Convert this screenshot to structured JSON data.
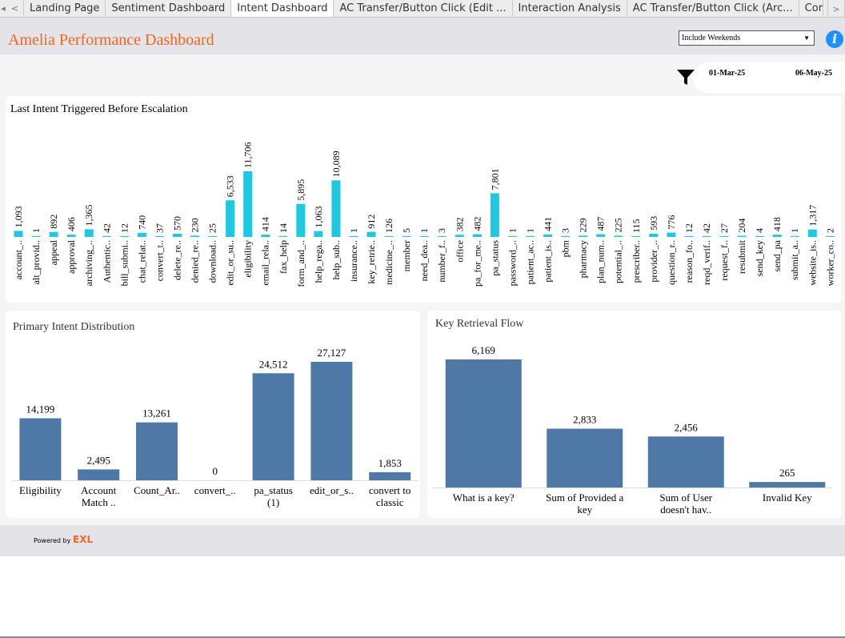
{
  "tabs": [
    {
      "label": "Landing Page",
      "active": false
    },
    {
      "label": "Sentiment Dashboard",
      "active": false
    },
    {
      "label": "Intent Dashboard",
      "active": true
    },
    {
      "label": "AC Transfer/Button Click (Edit ...",
      "active": false
    },
    {
      "label": "Interaction Analysis",
      "active": false
    },
    {
      "label": "AC Transfer/Button Click (Arc...",
      "active": false
    },
    {
      "label": "Cor",
      "active": false
    }
  ],
  "tab_nav": {
    "prev": "<",
    "next": ">",
    "first": "◂"
  },
  "header": {
    "title": "Amelia Performance Dashboard",
    "weekend_select_value": "Include Weekends",
    "info_icon": "i"
  },
  "date_filter": {
    "start": "01-Mar-25",
    "end": "06-May-25"
  },
  "footer": {
    "powered_by": "Powered by",
    "logo_text": "EXL"
  },
  "colors": {
    "accent": "#f26522",
    "cyan_bar": "#1ec8e1",
    "blue_bar": "#4e79a7",
    "info": "#1e90ff"
  },
  "chart_data": [
    {
      "type": "bar",
      "title": "Last Intent Triggered Before Escalation",
      "categories": [
        "account_..",
        "alt_provid..",
        "appeal",
        "approval",
        "archiving_..",
        "Authentic..",
        "bill_submi..",
        "chat_relat..",
        "convert_t..",
        "delete_re..",
        "denied_re..",
        "download..",
        "edit_or_su..",
        "eligibility",
        "email_rela..",
        "fax_help",
        "form_and_..",
        "help_rega..",
        "help_sub..",
        "insurance..",
        "key_retrie..",
        "medicine_..",
        "member",
        "need_dea..",
        "number_f..",
        "office",
        "pa_for_me..",
        "pa_status",
        "password_..",
        "patient_ac..",
        "patient_is..",
        "pbm",
        "pharmacy",
        "plan_num..",
        "potential_..",
        "prescriber..",
        "provider_..",
        "question_r..",
        "reason_fo..",
        "reqd_verif..",
        "request_f..",
        "resubmit",
        "send_key",
        "send_pa",
        "submit_a..",
        "website_is..",
        "worker_co.."
      ],
      "values": [
        1093,
        1,
        892,
        406,
        1365,
        42,
        12,
        740,
        37,
        570,
        230,
        25,
        6533,
        11706,
        414,
        14,
        5895,
        1063,
        10089,
        1,
        912,
        126,
        5,
        1,
        3,
        382,
        482,
        7801,
        1,
        1,
        441,
        3,
        229,
        487,
        225,
        115,
        593,
        776,
        12,
        42,
        27,
        204,
        4,
        418,
        1,
        1317,
        2
      ],
      "labels": [
        "1,093",
        "1",
        "892",
        "406",
        "1,365",
        "42",
        "12",
        "740",
        "37",
        "570",
        "230",
        "25",
        "6,533",
        "11,706",
        "414",
        "14",
        "5,895",
        "1,063",
        "10,089",
        "1",
        "912",
        "126",
        "5",
        "1",
        "3",
        "382",
        "482",
        "7,801",
        "1",
        "1",
        "441",
        "3",
        "229",
        "487",
        "225",
        "115",
        "593",
        "776",
        "12",
        "42",
        "27",
        "204",
        "4",
        "418",
        "1",
        "1,317",
        "2"
      ],
      "color": "#1ec8e1"
    },
    {
      "type": "bar",
      "title": "Primary Intent Distribution",
      "categories": [
        [
          "Eligibility"
        ],
        [
          "Account",
          "Match .."
        ],
        [
          "Count_Ar.."
        ],
        [
          "convert_.."
        ],
        [
          "pa_status",
          "(1)"
        ],
        [
          "edit_or_s.."
        ],
        [
          "convert to",
          "classic"
        ]
      ],
      "values": [
        14199,
        2495,
        13261,
        0,
        24512,
        27127,
        1853
      ],
      "labels": [
        "14,199",
        "2,495",
        "13,261",
        "0",
        "24,512",
        "27,127",
        "1,853"
      ],
      "color": "#4e79a7"
    },
    {
      "type": "bar",
      "title": "Key Retrieval Flow",
      "categories": [
        [
          "What is a key?"
        ],
        [
          "Sum of Provided a",
          "key"
        ],
        [
          "Sum of User",
          "doesn't hav.."
        ],
        [
          "Invalid Key"
        ]
      ],
      "values": [
        6169,
        2833,
        2456,
        265
      ],
      "labels": [
        "6,169",
        "2,833",
        "2,456",
        "265"
      ],
      "color": "#4e79a7"
    }
  ]
}
